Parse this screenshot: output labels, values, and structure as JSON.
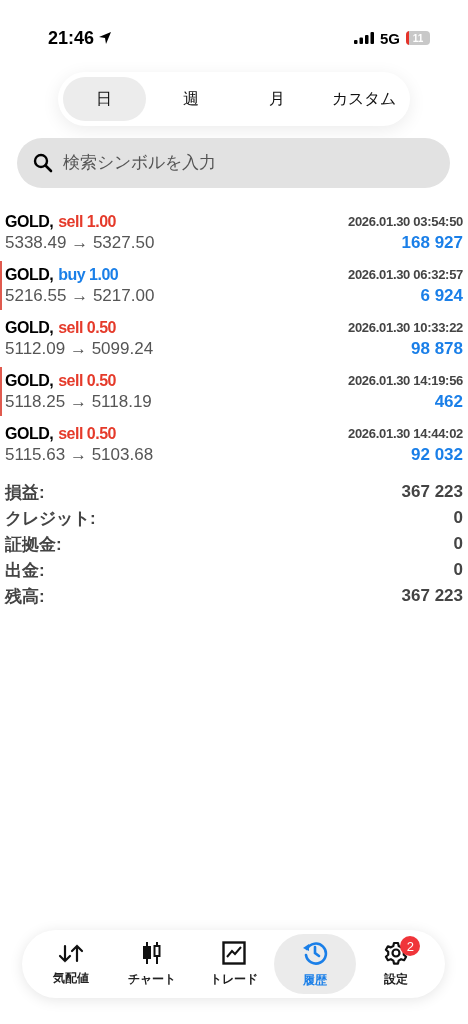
{
  "status_bar": {
    "time": "21:46",
    "network": "5G",
    "battery": "11"
  },
  "period_tabs": [
    {
      "label": "日",
      "selected": true
    },
    {
      "label": "週",
      "selected": false
    },
    {
      "label": "月",
      "selected": false
    },
    {
      "label": "カスタム",
      "selected": false
    }
  ],
  "search": {
    "placeholder": "検索シンボルを入力"
  },
  "trades": [
    {
      "symbol": "GOLD,",
      "kind": "sell",
      "action": "sell 1.00",
      "time": "2026.01.30 03:54:50",
      "prices": "5338.49 → 5327.50",
      "profit": "168 927",
      "marked": false
    },
    {
      "symbol": "GOLD,",
      "kind": "buy",
      "action": "buy 1.00",
      "time": "2026.01.30 06:32:57",
      "prices": "5216.55 → 5217.00",
      "profit": "6 924",
      "marked": true
    },
    {
      "symbol": "GOLD,",
      "kind": "sell",
      "action": "sell 0.50",
      "time": "2026.01.30 10:33:22",
      "prices": "5112.09 → 5099.24",
      "profit": "98 878",
      "marked": false
    },
    {
      "symbol": "GOLD,",
      "kind": "sell",
      "action": "sell 0.50",
      "time": "2026.01.30 14:19:56",
      "prices": "5118.25 → 5118.19",
      "profit": "462",
      "marked": true
    },
    {
      "symbol": "GOLD,",
      "kind": "sell",
      "action": "sell 0.50",
      "time": "2026.01.30 14:44:02",
      "prices": "5115.63 → 5103.68",
      "profit": "92 032",
      "marked": false
    }
  ],
  "summary": [
    {
      "label": "損益:",
      "value": "367 223"
    },
    {
      "label": "クレジット:",
      "value": "0"
    },
    {
      "label": "証拠金:",
      "value": "0"
    },
    {
      "label": "出金:",
      "value": "0"
    },
    {
      "label": "残高:",
      "value": "367 223"
    }
  ],
  "tab_bar": [
    {
      "kind": "quotes",
      "label": "気配値",
      "selected": false
    },
    {
      "kind": "chart",
      "label": "チャート",
      "selected": false
    },
    {
      "kind": "trade",
      "label": "トレード",
      "selected": false
    },
    {
      "kind": "history",
      "label": "履歴",
      "selected": true
    },
    {
      "kind": "settings",
      "label": "設定",
      "selected": false,
      "badge": "2"
    }
  ]
}
